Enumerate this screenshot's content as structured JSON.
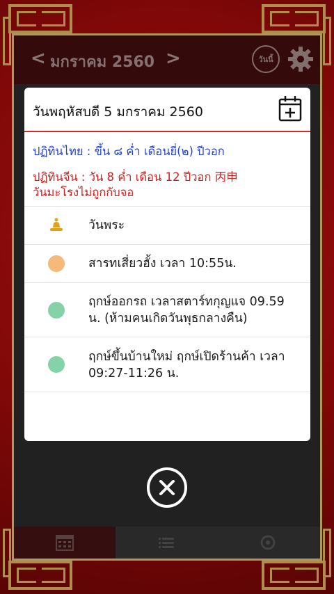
{
  "header": {
    "month_label": "มกราคม 2560",
    "today_label": "วันนี้",
    "prev_icon": "chevron-left-icon",
    "next_icon": "chevron-right-icon",
    "settings_icon": "gear-icon"
  },
  "dialog": {
    "title": "วันพฤหัสบดี 5 มกราคม 2560",
    "add_icon": "calendar-add-icon",
    "thai_lunar": "ปฏิทินไทย : ขึ้น ๘ ค่ำ เดือนยี่(๒) ปีวอก",
    "chinese_lunar": "ปฏิทินจีน   : วัน 8 ค่ำ เดือน 12 ปีวอก 丙申",
    "chinese_note": "วันมะโรงไม่ถูกกับจอ",
    "events": [
      {
        "icon": "buddha-icon",
        "text": "วันพระ"
      },
      {
        "icon": "orange-dot-icon",
        "color": "#f5b97a",
        "text": "สารทเสี่ยวฮั้ง เวลา 10:55น."
      },
      {
        "icon": "green-dot-icon",
        "color": "#84d3a8",
        "text": "ฤกษ์ออกรถ เวลาสตาร์ทกุญแจ 09.59 น. (ห้ามคนเกิดวันพุธกลางคืน)"
      },
      {
        "icon": "green-dot-icon",
        "color": "#84d3a8",
        "text": "ฤกษ์ขึ้นบ้านใหม่ ฤกษ์เปิดร้านค้า เวลา 09:27-11:26 น."
      }
    ]
  },
  "tabs": [
    {
      "icon": "calendar-grid-icon"
    },
    {
      "icon": "list-icon"
    },
    {
      "icon": "zodiac-icon"
    }
  ],
  "colors": {
    "thai_text": "#2a46c8",
    "chinese_text": "#d0211f",
    "accent_line": "#d3272a",
    "frame_gold": "#f6d07e"
  },
  "close_icon": "close-circle-icon"
}
